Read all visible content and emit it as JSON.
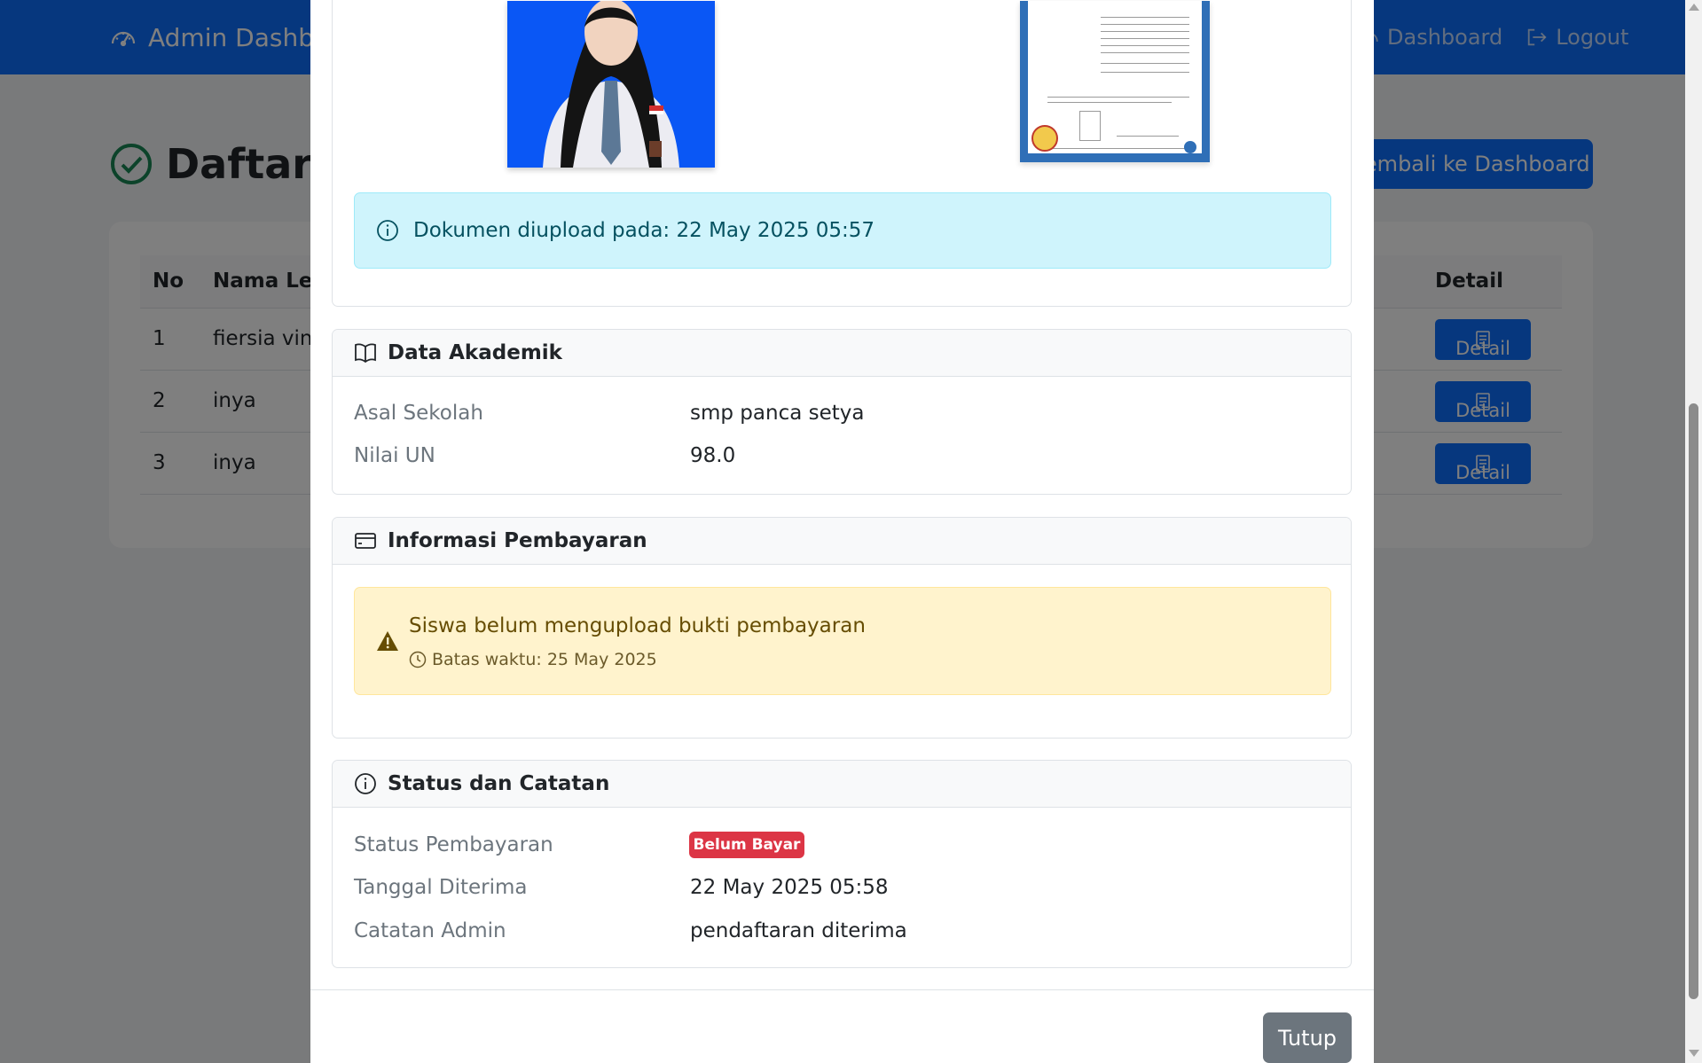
{
  "navbar": {
    "brand": "Admin Dashboard",
    "links": [
      "Dashboard",
      "Logout"
    ]
  },
  "page": {
    "title": "Daftar Siswa Diterima",
    "back_button": "Kembali ke Dashboard"
  },
  "table": {
    "headers": [
      "No",
      "Nama Lengkap",
      "Detail"
    ],
    "rows": [
      {
        "no": "1",
        "nama": "fiersia vinolia"
      },
      {
        "no": "2",
        "nama": "inya"
      },
      {
        "no": "3",
        "nama": "inya"
      }
    ],
    "detail_label": "Detail"
  },
  "modal": {
    "upload_notice": "Dokumen diupload pada: 22 May 2025 05:57",
    "academic": {
      "title": "Data Akademik",
      "asal_sekolah_label": "Asal Sekolah",
      "asal_sekolah_value": "smp panca setya",
      "nilai_un_label": "Nilai UN",
      "nilai_un_value": "98.0"
    },
    "payment": {
      "title": "Informasi Pembayaran",
      "warning": "Siswa belum mengupload bukti pembayaran",
      "deadline": "Batas waktu: 25 May 2025"
    },
    "status": {
      "title": "Status dan Catatan",
      "status_label": "Status Pembayaran",
      "status_badge": "Belum Bayar",
      "tanggal_label": "Tanggal Diterima",
      "tanggal_value": "22 May 2025 05:58",
      "catatan_label": "Catatan Admin",
      "catatan_value": "pendaftaran diterima"
    },
    "close_button": "Tutup"
  },
  "colors": {
    "primary": "#0d6efd",
    "info_bg": "#cff4fc",
    "warning_bg": "#fff3cd",
    "danger": "#dc3545",
    "secondary": "#6c757d"
  }
}
